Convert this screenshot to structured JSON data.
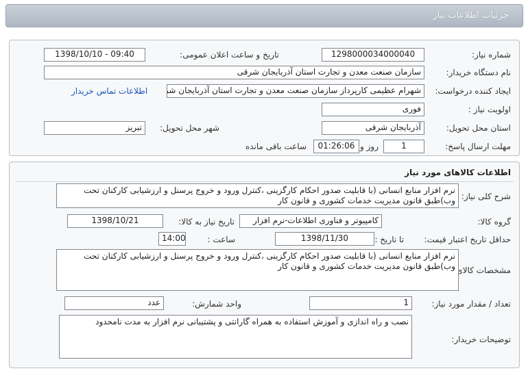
{
  "header": {
    "title": "جزئیات اطلاعات نیاز"
  },
  "info": {
    "need_number_label": "شماره نیاز:",
    "need_number": "1298000034000040",
    "announce_label": "تاریخ و ساعت اعلان عمومی:",
    "announce_value": "1398/10/10 - 09:40",
    "buyer_label": "نام دستگاه خریدار:",
    "buyer_value": "سازمان صنعت معدن و تجارت استان آذربایجان شرقی",
    "creator_label": "ایجاد کننده درخواست:",
    "creator_value": "شهرام عظیمی کارپرداز سازمان صنعت معدن و تجارت استان آذربایجان شرقی",
    "contact_link": "اطلاعات تماس خریدار",
    "priority_label": "اولویت نیاز :",
    "priority_value": "فوری",
    "province_label": "استان محل تحویل:",
    "province_value": "آذربایجان شرقی",
    "city_label": "شهر محل تحویل:",
    "city_value": "تبریز",
    "deadline_label": "مهلت ارسال پاسخ:",
    "deadline_days": "1",
    "days_label": "روز و",
    "deadline_time": "01:26:06",
    "remaining_label": "ساعت باقی مانده"
  },
  "goods": {
    "section_title": "اطلاعات کالاهای مورد نیاز",
    "summary_label": "شرح کلی نیاز:",
    "summary_value": "نرم افزار منابع انسانی (با قابلیت صدور احکام کارگزینی ،کنترل ورود و خروج پرسنل و ارزشیابی کارکنان تحت وب)طبق قانون مدیریت خدمات کشوری و قانون کار",
    "group_label": "گروه کالا:",
    "group_value": "کامپیوتر و فناوری اطلاعات-نرم افزار",
    "need_date_label": "تاریخ نیاز به کالا:",
    "need_date_value": "1398/10/21",
    "validity_label": "حداقل تاریخ اعتبار قیمت:",
    "until_label": "تا تاریخ :",
    "validity_date": "1398/11/30",
    "hour_label": "ساعت :",
    "validity_time": "14:00",
    "spec_label": "مشخصات کالای مورد نیاز:",
    "spec_value": "نرم افزار منابع انسانی (با قابلیت صدور احکام کارگزینی ،کنترل ورود و خروج پرسنل و ارزشیابی کارکنان تحت وب)طبق قانون مدیریت خدمات کشوری و قانون کار",
    "qty_label": "تعداد / مقدار مورد نیاز:",
    "qty_value": "1",
    "unit_label": "واحد شمارش:",
    "unit_value": "عدد",
    "notes_label": "توضیحات خریدار:",
    "notes_value": "نصب و راه اندازی و آموزش استفاده  به همراه گارانتی و پشتیبانی نرم افزار به مدت نامحدود"
  }
}
